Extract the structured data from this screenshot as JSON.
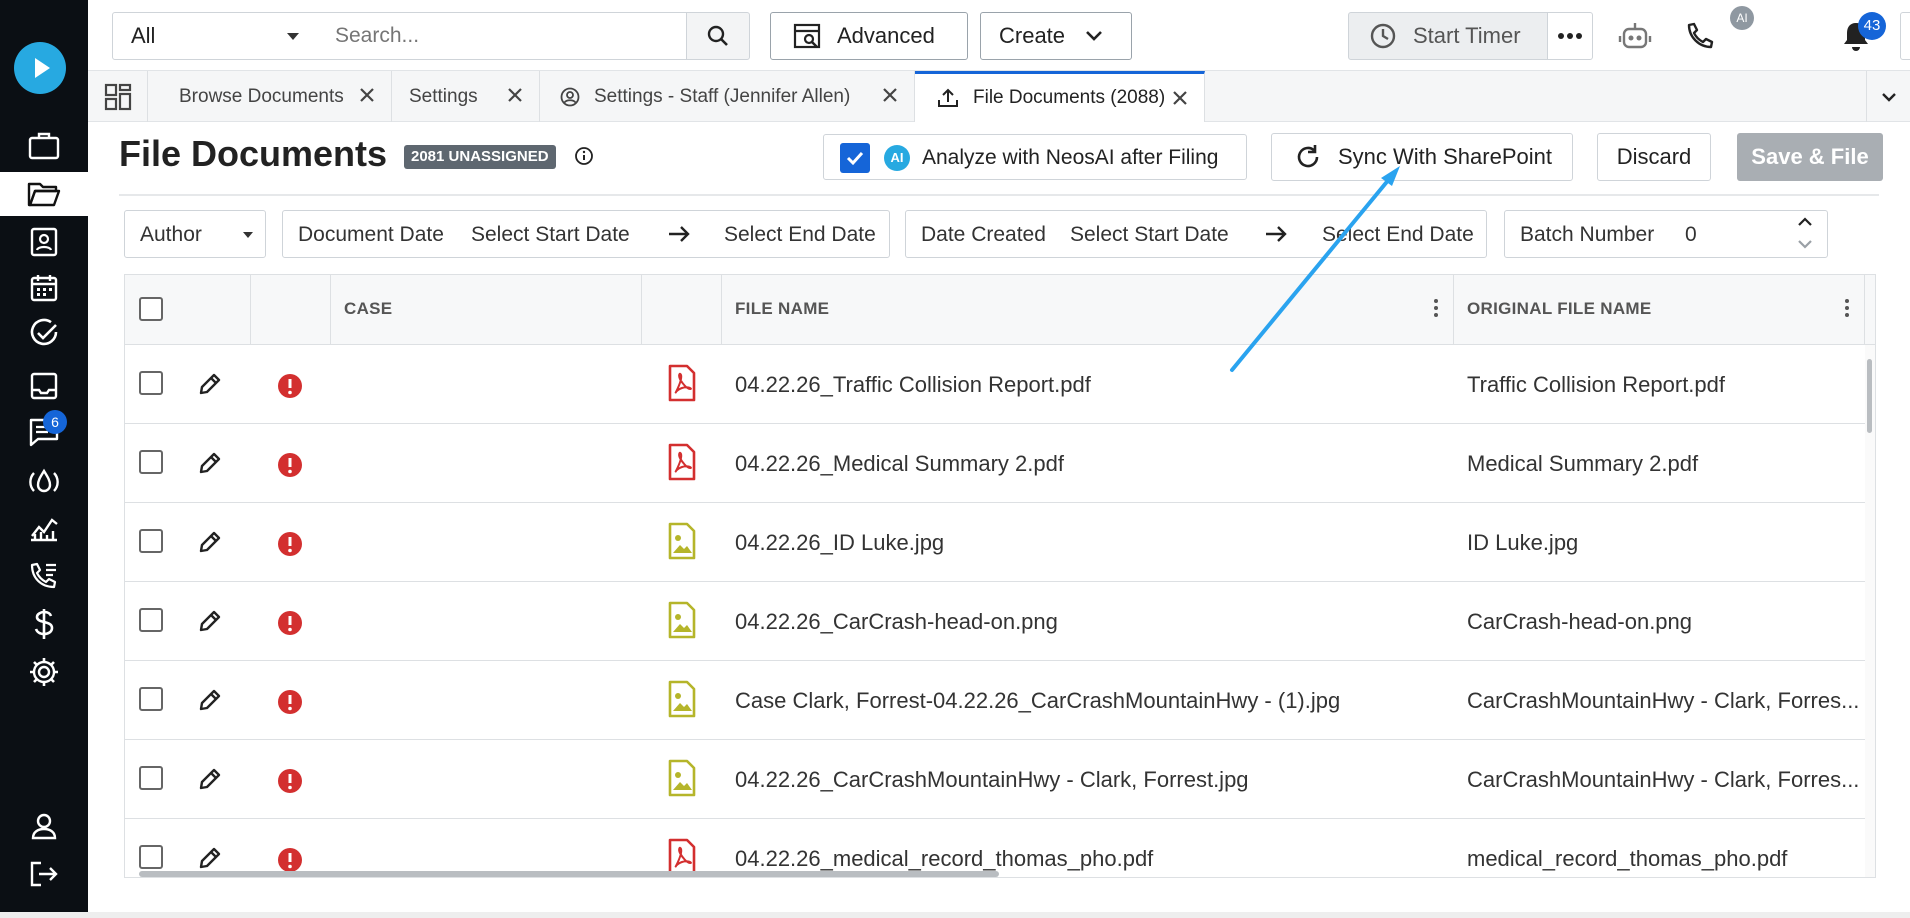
{
  "topbar": {
    "scope_value": "All",
    "search_placeholder": "Search...",
    "advanced_label": "Advanced",
    "create_label": "Create",
    "timer_label": "Start Timer",
    "ai_badge": "AI",
    "notification_count": "43"
  },
  "sidenav": {
    "messages_badge": "6",
    "items": [
      "logo",
      "briefcase",
      "folder-open",
      "contacts",
      "calendar",
      "tasks",
      "inbox",
      "messages",
      "intake",
      "reports",
      "calls",
      "billing",
      "settings",
      "profile",
      "logout"
    ]
  },
  "tabs": [
    {
      "label": "Browse Documents"
    },
    {
      "label": "Settings"
    },
    {
      "label": "Settings - Staff (Jennifer Allen)"
    },
    {
      "label": "File Documents (2088)",
      "active": true
    }
  ],
  "page": {
    "title": "File Documents",
    "unassigned_badge": "2081 UNASSIGNED",
    "analyze_label": "Analyze with NeosAI after Filing",
    "analyze_ai": "AI",
    "sync_label": "Sync With SharePoint",
    "discard_label": "Discard",
    "save_label": "Save & File"
  },
  "filters": {
    "author": "Author",
    "doc_date_label": "Document Date",
    "doc_start": "Select Start Date",
    "doc_end": "Select End Date",
    "created_label": "Date Created",
    "created_start": "Select Start Date",
    "created_end": "Select End Date",
    "batch_label": "Batch Number",
    "batch_value": "0"
  },
  "grid": {
    "columns": [
      "CASE",
      "FILE NAME",
      "ORIGINAL FILE NAME"
    ],
    "rows": [
      {
        "type": "pdf",
        "file_name": "04.22.26_Traffic Collision Report.pdf",
        "original": "Traffic Collision Report.pdf"
      },
      {
        "type": "pdf",
        "file_name": "04.22.26_Medical Summary 2.pdf",
        "original": "Medical Summary 2.pdf"
      },
      {
        "type": "image",
        "file_name": "04.22.26_ID Luke.jpg",
        "original": "ID Luke.jpg"
      },
      {
        "type": "image",
        "file_name": "04.22.26_CarCrash-head-on.png",
        "original": "CarCrash-head-on.png"
      },
      {
        "type": "image",
        "file_name": "Case Clark, Forrest-04.22.26_CarCrashMountainHwy - (1).jpg",
        "original": "CarCrashMountainHwy - Clark, Forres..."
      },
      {
        "type": "image",
        "file_name": "04.22.26_CarCrashMountainHwy - Clark, Forrest.jpg",
        "original": "CarCrashMountainHwy - Clark, Forres..."
      },
      {
        "type": "pdf",
        "file_name": "04.22.26_medical_record_thomas_pho.pdf",
        "original": "medical_record_thomas_pho.pdf"
      }
    ]
  },
  "colors": {
    "accent": "#1565d8",
    "pdf_icon": "#d32f2f",
    "image_icon": "#b5b52a",
    "error_icon": "#d32f2f",
    "annotation_arrow": "#2aa3ef"
  }
}
